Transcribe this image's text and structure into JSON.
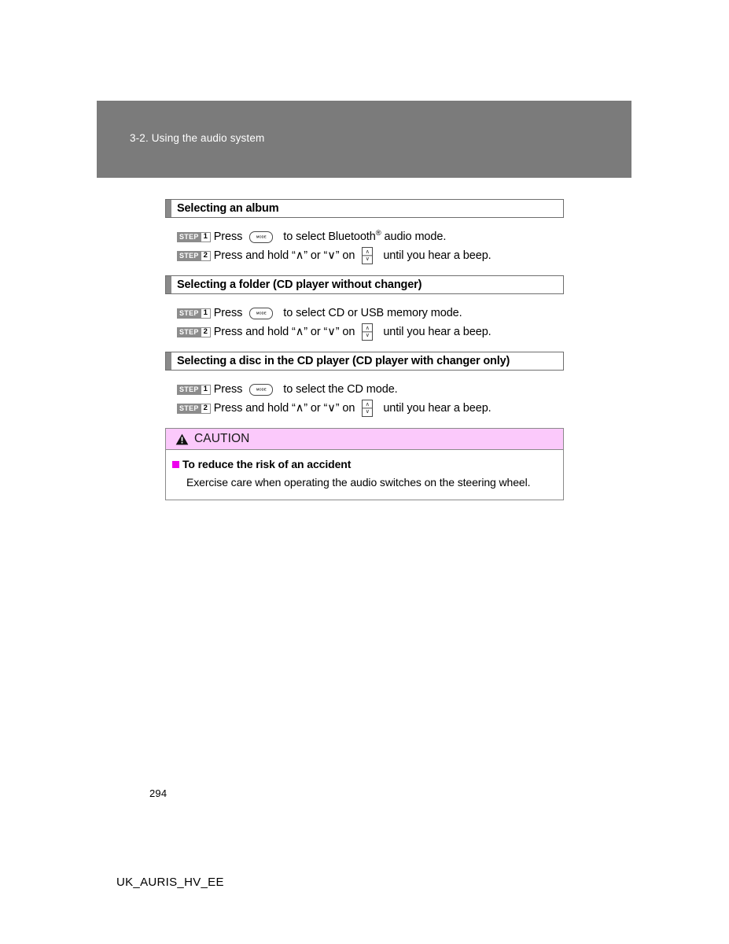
{
  "page": {
    "chapter_title": "3-2. Using the audio system",
    "page_number": "294",
    "doc_code": "UK_AURIS_HV_EE"
  },
  "icons": {
    "mode_button_label": "MODE",
    "up_arrow": "∧",
    "down_arrow": "∨",
    "warning_triangle": "warning-triangle-icon",
    "rocker_switch": "up-down-rocker-switch-icon"
  },
  "colors": {
    "band_gray": "#7b7b7b",
    "section_tab_gray": "#8a8a8a",
    "step_badge_gray": "#8c8c8c",
    "caution_pink": "#fbc9fb",
    "bullet_magenta": "#ee00ee"
  },
  "sections": [
    {
      "title": "Selecting an album",
      "steps": [
        {
          "badge_word": "STEP",
          "badge_num": "1",
          "text_before": "Press",
          "glyph": "mode-button",
          "text_after_1": "to select Bluetooth",
          "superscript": "®",
          "text_after_2": " audio mode."
        },
        {
          "badge_word": "STEP",
          "badge_num": "2",
          "text_before": "Press and hold “∧” or “∨” on",
          "glyph": "rocker-switch",
          "text_after_1": "until you hear a beep.",
          "superscript": "",
          "text_after_2": ""
        }
      ]
    },
    {
      "title": "Selecting a folder (CD player without changer)",
      "steps": [
        {
          "badge_word": "STEP",
          "badge_num": "1",
          "text_before": "Press",
          "glyph": "mode-button",
          "text_after_1": "to select CD or USB memory mode.",
          "superscript": "",
          "text_after_2": ""
        },
        {
          "badge_word": "STEP",
          "badge_num": "2",
          "text_before": "Press and hold “∧” or “∨” on",
          "glyph": "rocker-switch",
          "text_after_1": "until you hear a beep.",
          "superscript": "",
          "text_after_2": ""
        }
      ]
    },
    {
      "title": "Selecting a disc in the CD player (CD player with changer only)",
      "steps": [
        {
          "badge_word": "STEP",
          "badge_num": "1",
          "text_before": "Press",
          "glyph": "mode-button",
          "text_after_1": "to select the CD mode.",
          "superscript": "",
          "text_after_2": ""
        },
        {
          "badge_word": "STEP",
          "badge_num": "2",
          "text_before": "Press and hold “∧” or “∨” on",
          "glyph": "rocker-switch",
          "text_after_1": "until you hear a beep.",
          "superscript": "",
          "text_after_2": ""
        }
      ]
    }
  ],
  "caution": {
    "label": "CAUTION",
    "subtitle": "To reduce the risk of an accident",
    "body": "Exercise care when operating the audio switches on the steering wheel."
  }
}
